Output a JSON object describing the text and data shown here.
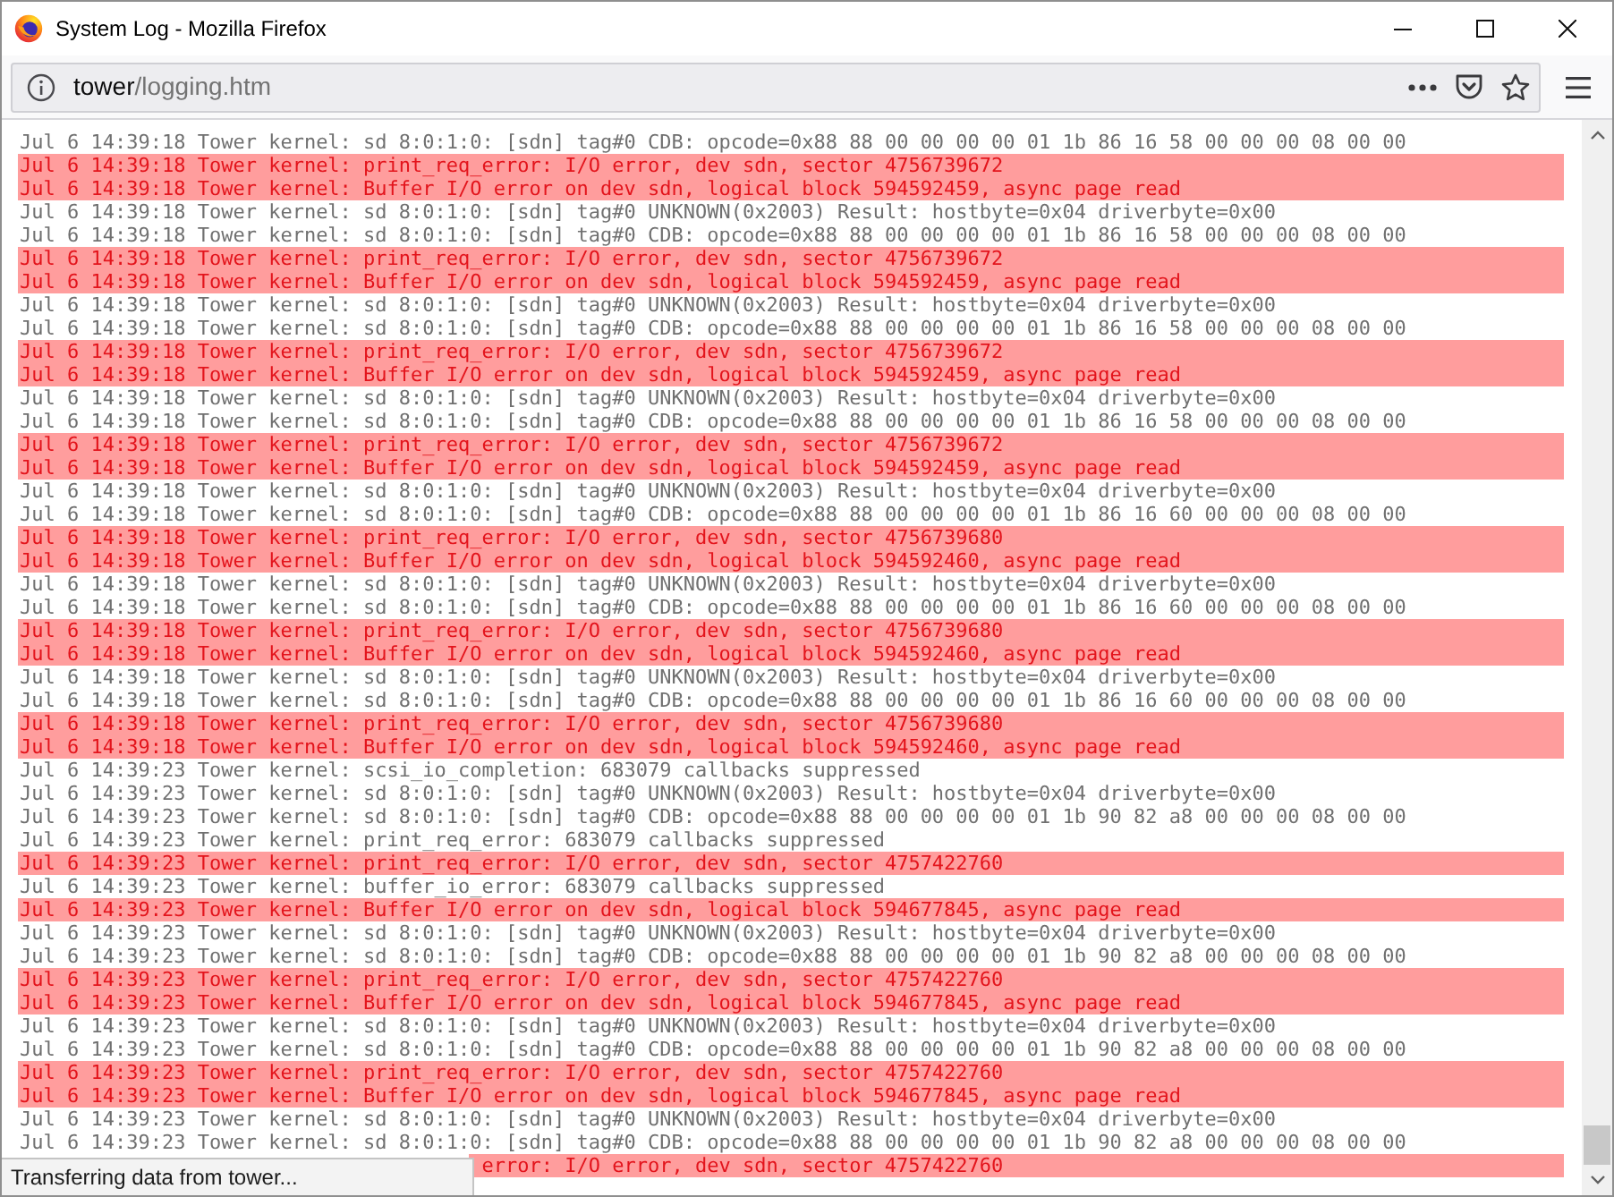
{
  "window": {
    "title": "System Log - Mozilla Firefox"
  },
  "address_bar": {
    "host": "tower",
    "path": "/logging.htm"
  },
  "log": {
    "lines": [
      {
        "kind": "info",
        "text": "Jul 6 14:39:18 Tower kernel: sd 8:0:1:0: [sdn] tag#0 CDB: opcode=0x88 88 00 00 00 00 01 1b 86 16 58 00 00 00 08 00 00"
      },
      {
        "kind": "error",
        "text": "Jul 6 14:39:18 Tower kernel: print_req_error: I/O error, dev sdn, sector 4756739672"
      },
      {
        "kind": "error",
        "text": "Jul 6 14:39:18 Tower kernel: Buffer I/O error on dev sdn, logical block 594592459, async page read"
      },
      {
        "kind": "info",
        "text": "Jul 6 14:39:18 Tower kernel: sd 8:0:1:0: [sdn] tag#0 UNKNOWN(0x2003) Result: hostbyte=0x04 driverbyte=0x00"
      },
      {
        "kind": "info",
        "text": "Jul 6 14:39:18 Tower kernel: sd 8:0:1:0: [sdn] tag#0 CDB: opcode=0x88 88 00 00 00 00 01 1b 86 16 58 00 00 00 08 00 00"
      },
      {
        "kind": "error",
        "text": "Jul 6 14:39:18 Tower kernel: print_req_error: I/O error, dev sdn, sector 4756739672"
      },
      {
        "kind": "error",
        "text": "Jul 6 14:39:18 Tower kernel: Buffer I/O error on dev sdn, logical block 594592459, async page read"
      },
      {
        "kind": "info",
        "text": "Jul 6 14:39:18 Tower kernel: sd 8:0:1:0: [sdn] tag#0 UNKNOWN(0x2003) Result: hostbyte=0x04 driverbyte=0x00"
      },
      {
        "kind": "info",
        "text": "Jul 6 14:39:18 Tower kernel: sd 8:0:1:0: [sdn] tag#0 CDB: opcode=0x88 88 00 00 00 00 01 1b 86 16 58 00 00 00 08 00 00"
      },
      {
        "kind": "error",
        "text": "Jul 6 14:39:18 Tower kernel: print_req_error: I/O error, dev sdn, sector 4756739672"
      },
      {
        "kind": "error",
        "text": "Jul 6 14:39:18 Tower kernel: Buffer I/O error on dev sdn, logical block 594592459, async page read"
      },
      {
        "kind": "info",
        "text": "Jul 6 14:39:18 Tower kernel: sd 8:0:1:0: [sdn] tag#0 UNKNOWN(0x2003) Result: hostbyte=0x04 driverbyte=0x00"
      },
      {
        "kind": "info",
        "text": "Jul 6 14:39:18 Tower kernel: sd 8:0:1:0: [sdn] tag#0 CDB: opcode=0x88 88 00 00 00 00 01 1b 86 16 58 00 00 00 08 00 00"
      },
      {
        "kind": "error",
        "text": "Jul 6 14:39:18 Tower kernel: print_req_error: I/O error, dev sdn, sector 4756739672"
      },
      {
        "kind": "error",
        "text": "Jul 6 14:39:18 Tower kernel: Buffer I/O error on dev sdn, logical block 594592459, async page read"
      },
      {
        "kind": "info",
        "text": "Jul 6 14:39:18 Tower kernel: sd 8:0:1:0: [sdn] tag#0 UNKNOWN(0x2003) Result: hostbyte=0x04 driverbyte=0x00"
      },
      {
        "kind": "info",
        "text": "Jul 6 14:39:18 Tower kernel: sd 8:0:1:0: [sdn] tag#0 CDB: opcode=0x88 88 00 00 00 00 01 1b 86 16 60 00 00 00 08 00 00"
      },
      {
        "kind": "error",
        "text": "Jul 6 14:39:18 Tower kernel: print_req_error: I/O error, dev sdn, sector 4756739680"
      },
      {
        "kind": "error",
        "text": "Jul 6 14:39:18 Tower kernel: Buffer I/O error on dev sdn, logical block 594592460, async page read"
      },
      {
        "kind": "info",
        "text": "Jul 6 14:39:18 Tower kernel: sd 8:0:1:0: [sdn] tag#0 UNKNOWN(0x2003) Result: hostbyte=0x04 driverbyte=0x00"
      },
      {
        "kind": "info",
        "text": "Jul 6 14:39:18 Tower kernel: sd 8:0:1:0: [sdn] tag#0 CDB: opcode=0x88 88 00 00 00 00 01 1b 86 16 60 00 00 00 08 00 00"
      },
      {
        "kind": "error",
        "text": "Jul 6 14:39:18 Tower kernel: print_req_error: I/O error, dev sdn, sector 4756739680"
      },
      {
        "kind": "error",
        "text": "Jul 6 14:39:18 Tower kernel: Buffer I/O error on dev sdn, logical block 594592460, async page read"
      },
      {
        "kind": "info",
        "text": "Jul 6 14:39:18 Tower kernel: sd 8:0:1:0: [sdn] tag#0 UNKNOWN(0x2003) Result: hostbyte=0x04 driverbyte=0x00"
      },
      {
        "kind": "info",
        "text": "Jul 6 14:39:18 Tower kernel: sd 8:0:1:0: [sdn] tag#0 CDB: opcode=0x88 88 00 00 00 00 01 1b 86 16 60 00 00 00 08 00 00"
      },
      {
        "kind": "error",
        "text": "Jul 6 14:39:18 Tower kernel: print_req_error: I/O error, dev sdn, sector 4756739680"
      },
      {
        "kind": "error",
        "text": "Jul 6 14:39:18 Tower kernel: Buffer I/O error on dev sdn, logical block 594592460, async page read"
      },
      {
        "kind": "info",
        "text": "Jul 6 14:39:23 Tower kernel: scsi_io_completion: 683079 callbacks suppressed"
      },
      {
        "kind": "info",
        "text": "Jul 6 14:39:23 Tower kernel: sd 8:0:1:0: [sdn] tag#0 UNKNOWN(0x2003) Result: hostbyte=0x04 driverbyte=0x00"
      },
      {
        "kind": "info",
        "text": "Jul 6 14:39:23 Tower kernel: sd 8:0:1:0: [sdn] tag#0 CDB: opcode=0x88 88 00 00 00 00 01 1b 90 82 a8 00 00 00 08 00 00"
      },
      {
        "kind": "info",
        "text": "Jul 6 14:39:23 Tower kernel: print_req_error: 683079 callbacks suppressed"
      },
      {
        "kind": "error",
        "text": "Jul 6 14:39:23 Tower kernel: print_req_error: I/O error, dev sdn, sector 4757422760"
      },
      {
        "kind": "info",
        "text": "Jul 6 14:39:23 Tower kernel: buffer_io_error: 683079 callbacks suppressed"
      },
      {
        "kind": "error",
        "text": "Jul 6 14:39:23 Tower kernel: Buffer I/O error on dev sdn, logical block 594677845, async page read"
      },
      {
        "kind": "info",
        "text": "Jul 6 14:39:23 Tower kernel: sd 8:0:1:0: [sdn] tag#0 UNKNOWN(0x2003) Result: hostbyte=0x04 driverbyte=0x00"
      },
      {
        "kind": "info",
        "text": "Jul 6 14:39:23 Tower kernel: sd 8:0:1:0: [sdn] tag#0 CDB: opcode=0x88 88 00 00 00 00 01 1b 90 82 a8 00 00 00 08 00 00"
      },
      {
        "kind": "error",
        "text": "Jul 6 14:39:23 Tower kernel: print_req_error: I/O error, dev sdn, sector 4757422760"
      },
      {
        "kind": "error",
        "text": "Jul 6 14:39:23 Tower kernel: Buffer I/O error on dev sdn, logical block 594677845, async page read"
      },
      {
        "kind": "info",
        "text": "Jul 6 14:39:23 Tower kernel: sd 8:0:1:0: [sdn] tag#0 UNKNOWN(0x2003) Result: hostbyte=0x04 driverbyte=0x00"
      },
      {
        "kind": "info",
        "text": "Jul 6 14:39:23 Tower kernel: sd 8:0:1:0: [sdn] tag#0 CDB: opcode=0x88 88 00 00 00 00 01 1b 90 82 a8 00 00 00 08 00 00"
      },
      {
        "kind": "error",
        "text": "Jul 6 14:39:23 Tower kernel: print_req_error: I/O error, dev sdn, sector 4757422760"
      },
      {
        "kind": "error",
        "text": "Jul 6 14:39:23 Tower kernel: Buffer I/O error on dev sdn, logical block 594677845, async page read"
      },
      {
        "kind": "info",
        "text": "Jul 6 14:39:23 Tower kernel: sd 8:0:1:0: [sdn] tag#0 UNKNOWN(0x2003) Result: hostbyte=0x04 driverbyte=0x00"
      },
      {
        "kind": "info",
        "text": "Jul 6 14:39:23 Tower kernel: sd 8:0:1:0: [sdn] tag#0 CDB: opcode=0x88 88 00 00 00 00 01 1b 90 82 a8 00 00 00 08 00 00"
      },
      {
        "kind": "error",
        "text": "error: I/O error, dev sdn, sector 4757422760",
        "covered": true
      }
    ]
  },
  "status_panel": {
    "text": "Transferring data from tower..."
  }
}
